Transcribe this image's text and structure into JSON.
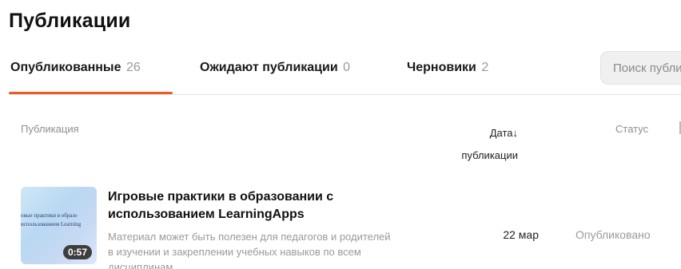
{
  "page": {
    "title": "Публикации"
  },
  "tabs": [
    {
      "label": "Опубликованные",
      "count": "26"
    },
    {
      "label": "Ожидают публикации",
      "count": "0"
    },
    {
      "label": "Черновики",
      "count": "2"
    }
  ],
  "search": {
    "placeholder": "Поиск публикаций"
  },
  "columns": {
    "publication": "Публикация",
    "date": "Дата",
    "date_line2": "публикации",
    "sort_arrow": "↓",
    "status": "Статус"
  },
  "rows": [
    {
      "thumbnail_lines": [
        "овые практики в образо",
        "использованием Learning"
      ],
      "duration": "0:57",
      "title": "Игровые практики в образовании с использованием LearningApps",
      "description": "Материал может быть полезен для педагогов и родителей в изучении и закреплении учебных навыков по всем дисциплинам",
      "date": "22 мар",
      "status": "Опубликовано"
    }
  ],
  "colors": {
    "accent": "#ee5a24"
  }
}
